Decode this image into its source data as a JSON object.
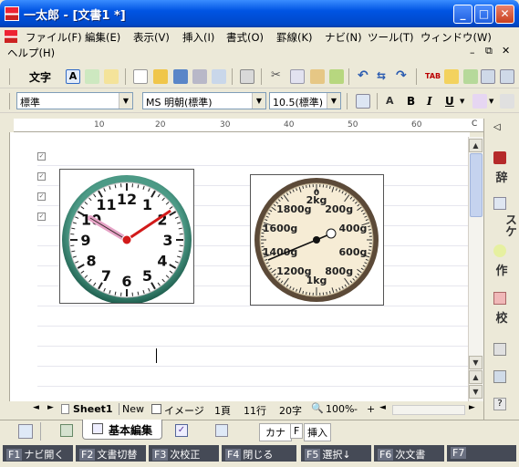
{
  "window": {
    "title": "一太郎 - [文書1 *]",
    "min": "_",
    "max": "□",
    "close": "✕"
  },
  "menu": [
    {
      "label": "ファイル(F)"
    },
    {
      "label": "編集(E)"
    },
    {
      "label": "表示(V)"
    },
    {
      "label": "挿入(I)"
    },
    {
      "label": "書式(O)"
    },
    {
      "label": "罫線(K)"
    },
    {
      "label": "ナビ(N)"
    },
    {
      "label": "ツール(T)"
    },
    {
      "label": "ウィンドウ(W)"
    },
    {
      "label": "ヘルプ(H)"
    }
  ],
  "toolbar": {
    "text_mode": "文字"
  },
  "format": {
    "style": "標準",
    "font": "MS 明朝(標準)",
    "size": "10.5(標準)",
    "bold": "B",
    "italic": "I",
    "underline": "U",
    "tab_label": "TAB"
  },
  "ruler": {
    "ticks": [
      "10",
      "20",
      "30",
      "40",
      "50",
      "60"
    ],
    "end": "C"
  },
  "left_ruler": {
    "ticks": [
      "5",
      "10"
    ]
  },
  "clock": {
    "numbers": [
      "12",
      "1",
      "2",
      "3",
      "4",
      "5",
      "6",
      "7",
      "8",
      "9",
      "10",
      "11"
    ]
  },
  "scale": {
    "labels": [
      "0",
      "2kg",
      "200g",
      "400g",
      "600g",
      "800g",
      "1kg",
      "1200g",
      "1400g",
      "1600g",
      "1800g"
    ]
  },
  "status": {
    "sheet": "Sheet1",
    "new": "New",
    "image": "イメージ",
    "page": "1頁",
    "line": "11行",
    "column": "20字",
    "zoom": "100%",
    "minus": "-",
    "plus": "+"
  },
  "tabs": {
    "basic_edit": "基本編集",
    "kana": "カナ",
    "f": "F",
    "insert": "挿入"
  },
  "fkeys": [
    {
      "key": "F1",
      "label": "ナビ開く"
    },
    {
      "key": "F2",
      "label": "文書切替"
    },
    {
      "key": "F3",
      "label": "次校正"
    },
    {
      "key": "F4",
      "label": "閉じる"
    },
    {
      "key": "F5",
      "label": "選択↓"
    },
    {
      "key": "F6",
      "label": "次文書"
    },
    {
      "key": "F7",
      "label": ""
    }
  ],
  "right_panel": {
    "dict": "辞",
    "sketch": "スケ",
    "create": "作",
    "proof": "校",
    "help": "?"
  }
}
